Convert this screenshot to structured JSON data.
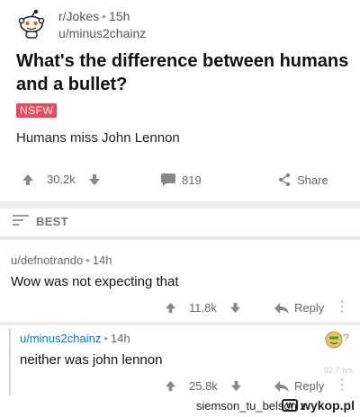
{
  "post": {
    "subreddit": "r/Jokes",
    "time": "15h",
    "author": "u/minus2chainz",
    "title": "What's the difference between humans and a bullet?",
    "nsfw_badge": "NSFW",
    "body": "Humans miss John Lennon",
    "upvotes": "30.2k",
    "comments": "819",
    "share": "Share"
  },
  "sort": {
    "label": "BEST"
  },
  "comments": [
    {
      "author": "u/defnotrando",
      "time": "14h",
      "text": "Wow was not expecting that",
      "score": "11.8k",
      "reply_label": "Reply"
    },
    {
      "author": "u/minus2chainz",
      "time": "14h",
      "text": "neither was john lennon",
      "score": "25.8k",
      "reply_label": "Reply"
    }
  ],
  "watermark": "92.7 tys.",
  "footer": {
    "source": "siemson_tu_belson z",
    "site": "wykop.pl"
  },
  "colors": {
    "nsfw": "#e84b5a",
    "divider": "#ececec",
    "author_link": "#0079d3"
  }
}
